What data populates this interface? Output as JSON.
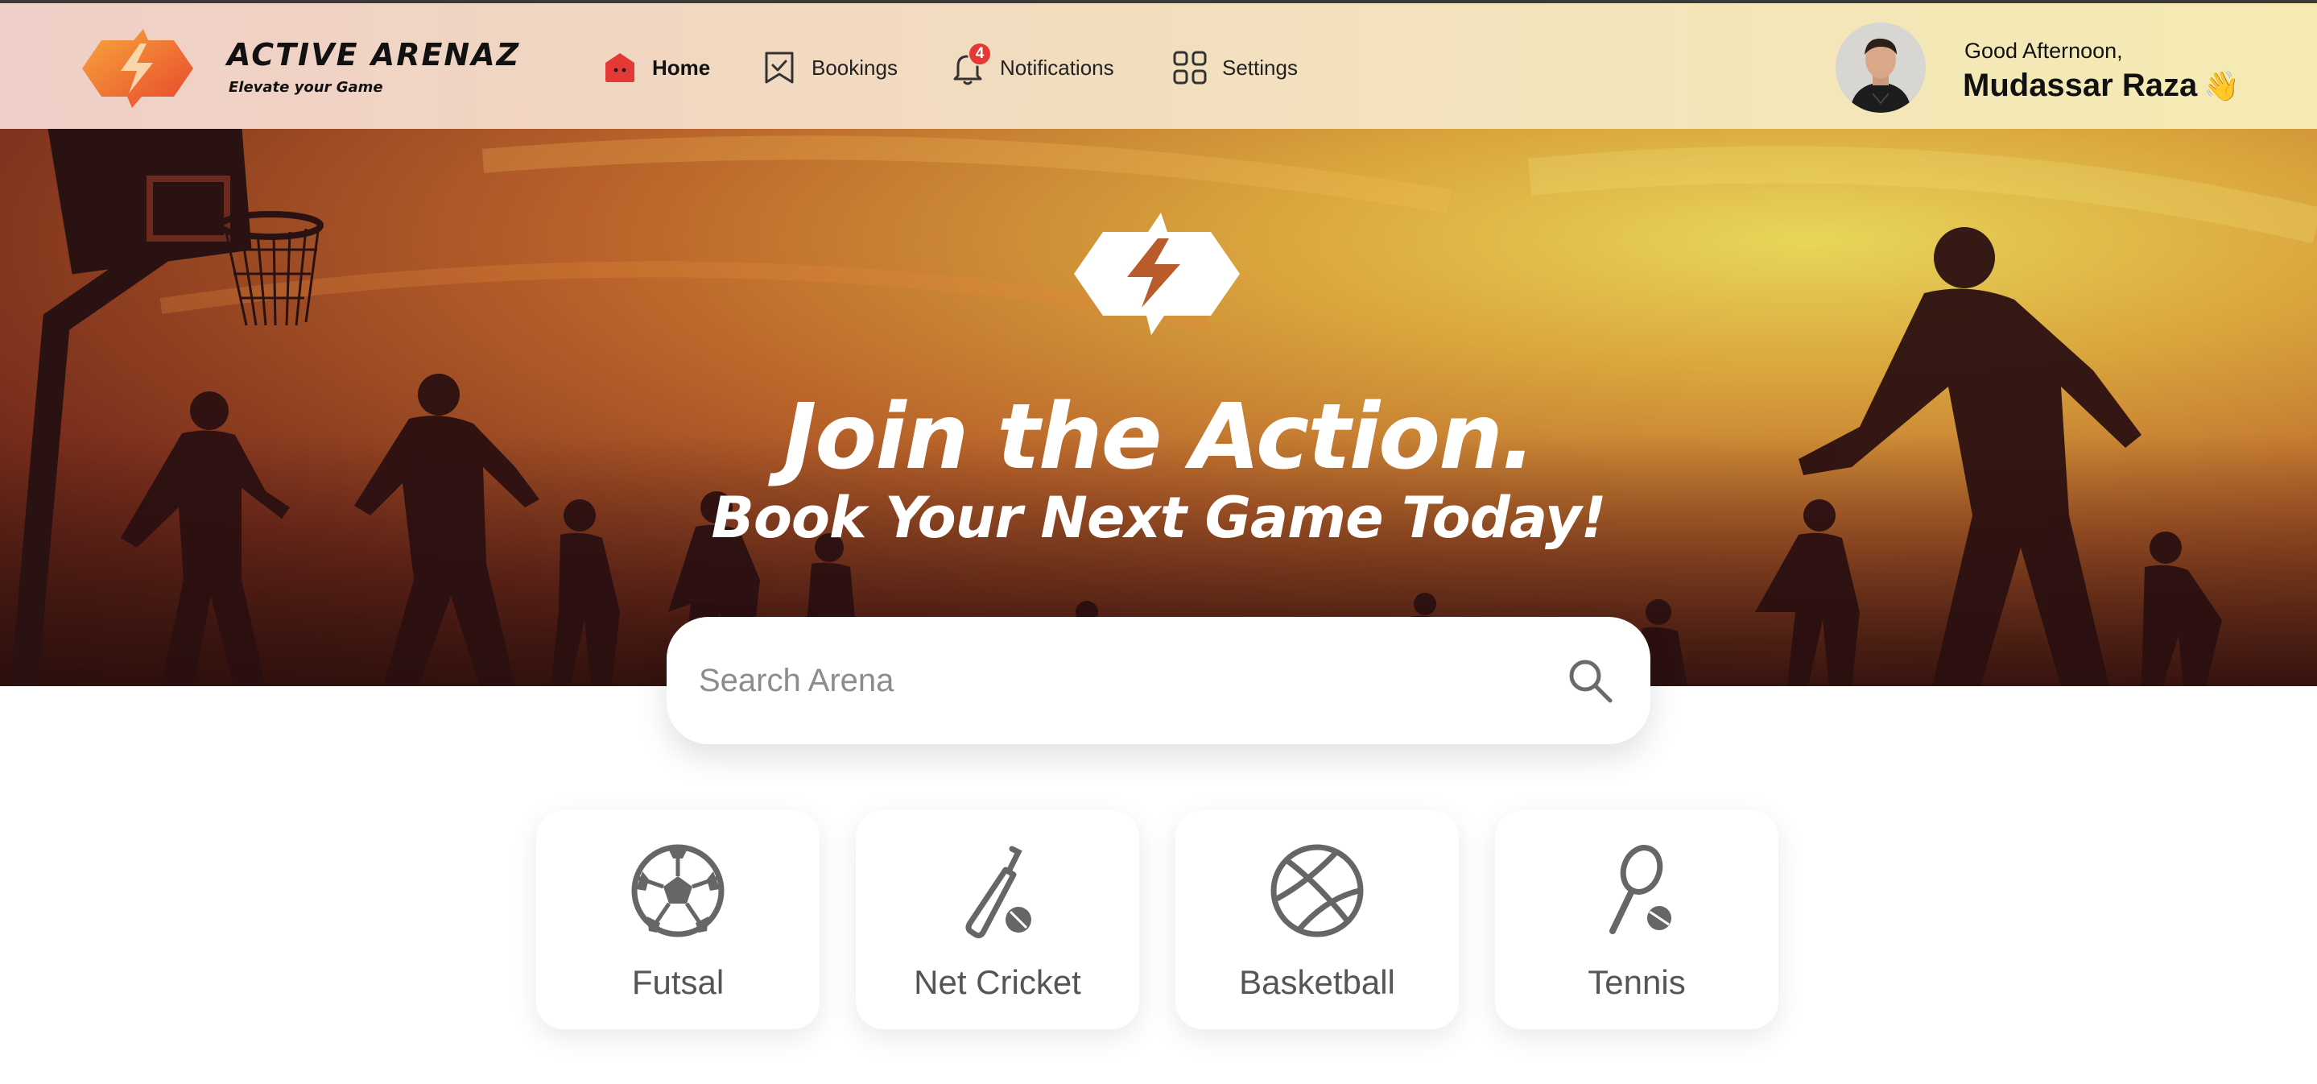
{
  "brand": {
    "name": "ACTIVE ARENAZ",
    "tagline": "Elevate your Game",
    "logo_colors": [
      "#f7a23a",
      "#e8452c"
    ]
  },
  "nav": {
    "items": [
      {
        "label": "Home",
        "icon": "home-icon",
        "active": true
      },
      {
        "label": "Bookings",
        "icon": "bookmark-check-icon",
        "active": false
      },
      {
        "label": "Notifications",
        "icon": "bell-icon",
        "active": false,
        "badge": "4"
      },
      {
        "label": "Settings",
        "icon": "grid-icon",
        "active": false
      }
    ]
  },
  "user": {
    "greeting": "Good Afternoon,",
    "name": "Mudassar Raza",
    "emoji": "👋"
  },
  "hero": {
    "title": "Join the Action.",
    "subtitle": "Book Your Next Game Today!"
  },
  "search": {
    "placeholder": "Search Arena",
    "value": ""
  },
  "categories": [
    {
      "label": "Futsal",
      "icon": "soccer-ball-icon"
    },
    {
      "label": "Net Cricket",
      "icon": "cricket-bat-icon"
    },
    {
      "label": "Basketball",
      "icon": "basketball-icon"
    },
    {
      "label": "Tennis",
      "icon": "tennis-racket-icon"
    }
  ],
  "colors": {
    "accent": "#e53935",
    "icon_gray": "#666666",
    "text_dark": "#111111"
  }
}
